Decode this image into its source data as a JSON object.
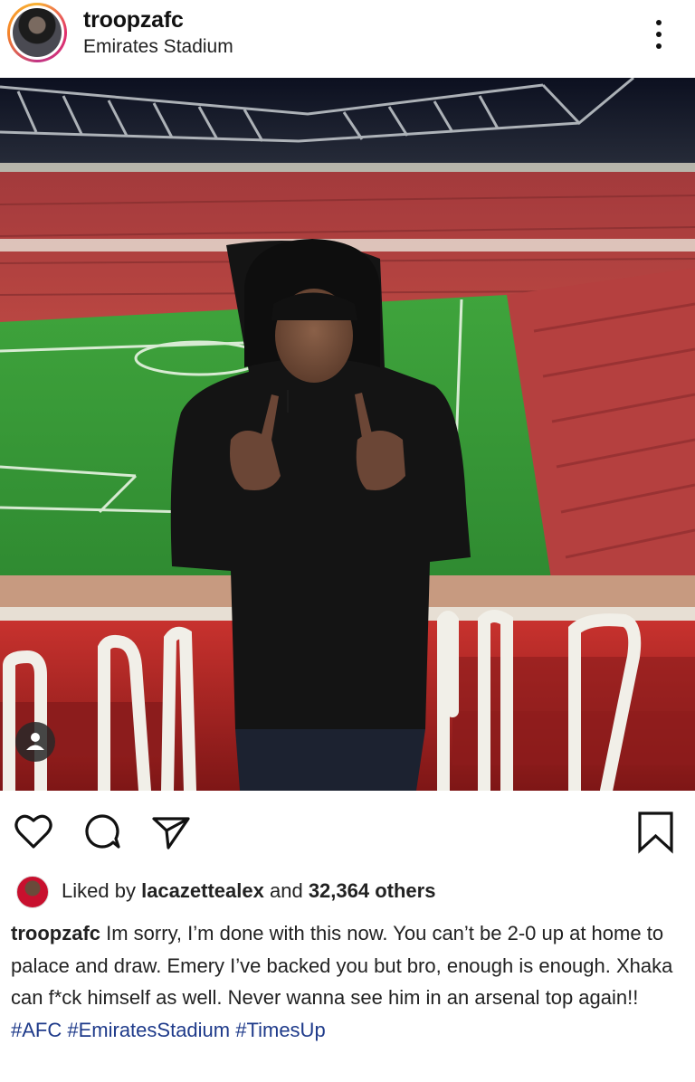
{
  "post": {
    "username": "troopzafc",
    "location": "Emirates Stadium"
  },
  "likes": {
    "prefix": "Liked by",
    "user": "lacazettealex",
    "conjunction": "and",
    "others": "32,364 others"
  },
  "caption": {
    "username": "troopzafc",
    "text": "Im sorry, I’m done with this now. You can’t be 2-0 up at home to palace and draw. Emery I’ve backed you but bro, enough is enough. Xhaka can f*ck himself as well. Never wanna see him in an arsenal top again!!",
    "hashtags": [
      "#AFC",
      "#EmiratesStadium",
      "#TimesUp"
    ]
  },
  "colors": {
    "hashtag": "#1e3a8a",
    "seat_red": "#b8242c",
    "pitch_green": "#3f9a3a"
  },
  "icons": [
    "more-options-icon",
    "heart-icon",
    "comment-icon",
    "share-icon",
    "bookmark-icon",
    "user-tag-icon"
  ]
}
